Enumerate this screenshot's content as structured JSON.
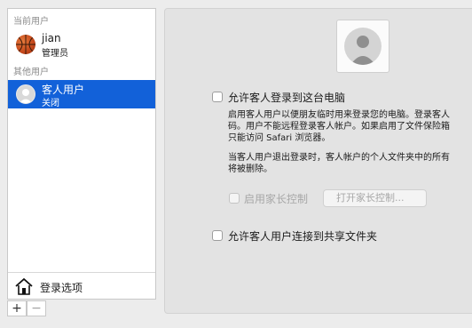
{
  "sidebar": {
    "current_user_header": "当前用户",
    "current_user": {
      "name": "jian",
      "role": "管理员"
    },
    "other_users_header": "其他用户",
    "guest_user": {
      "name": "客人用户",
      "status": "关闭"
    },
    "login_options_label": "登录选项",
    "add_label": "+",
    "remove_label": "−"
  },
  "main": {
    "allow_guest_login": {
      "label": "允许客人登录到这台电脑",
      "checked": false
    },
    "description": [
      "启用客人用户以便朋友临时用来登录您的电脑。登录客人",
      "码。用户不能远程登录客人帐户。如果启用了文件保险箱",
      "只能访问 Safari 浏览器。"
    ],
    "logout_note": [
      "当客人用户退出登录时，客人帐户的个人文件夹中的所有",
      "将被删除。"
    ],
    "parental_controls": {
      "label": "启用家长控制",
      "checked": false,
      "enabled": false
    },
    "open_parental_button": "打开家长控制...",
    "allow_shared_folders": {
      "label": "允许客人用户连接到共享文件夹",
      "checked": false
    }
  },
  "colors": {
    "selection": "#1261d9",
    "window_bg": "#ececec",
    "panel_bg": "#e3e3e3"
  },
  "icons": [
    "basketball-avatar-icon",
    "guest-avatar-icon",
    "home-icon",
    "plus-icon",
    "minus-icon",
    "user-silhouette-icon"
  ]
}
